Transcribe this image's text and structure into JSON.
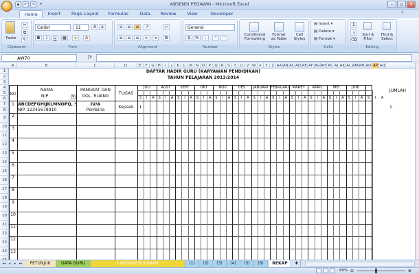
{
  "window": {
    "title": "ABSENSI PEGAWAI - Microsoft Excel"
  },
  "tabs": [
    "Home",
    "Insert",
    "Page Layout",
    "Formulas",
    "Data",
    "Review",
    "View",
    "Developer"
  ],
  "ribbon": {
    "clipboard": {
      "label": "Clipboard",
      "paste": "Paste"
    },
    "font": {
      "label": "Font",
      "name": "Calibri",
      "size": "11"
    },
    "alignment": {
      "label": "Alignment"
    },
    "number": {
      "label": "Number",
      "format": "General"
    },
    "styles": {
      "label": "Styles",
      "conditional": "Conditional",
      "conditional2": "Formatting",
      "format_table": "Format",
      "format_table2": "as Table",
      "cell_styles": "Cell",
      "cell_styles2": "Styles"
    },
    "cells": {
      "label": "Cells",
      "insert": "Insert",
      "delete": "Delete",
      "format": "Format"
    },
    "editing": {
      "label": "Editing",
      "sort": "Sort &",
      "sort2": "Filter",
      "find": "Find &",
      "find2": "Select"
    }
  },
  "formula_bar": {
    "name_box": "AW70",
    "fx": "fx",
    "content": ""
  },
  "sheet": {
    "title1": "DAFTAR HADIR GURU (KARYAWAN PENDIDIKAN)",
    "title2": "TAHUN PELAJARAN 2013/2014",
    "headers": {
      "no": "NO",
      "nama": "NAMA",
      "nip": "NIP",
      "pangkat1": "PANGKAT DAN",
      "pangkat2": "GOL. RUANG",
      "tugas": "TUGAS",
      "jumlah": "JUMLAH"
    },
    "months": [
      "JULI",
      "AGST",
      "SEPT",
      "OKT",
      "NOV",
      "DES",
      "JANUARI",
      "FEBRUARI",
      "MARET",
      "APRIL",
      "MEI",
      "JUNI"
    ],
    "sia": [
      "S",
      "I",
      "A"
    ],
    "row1": {
      "no": "1",
      "nama": "ABCDEFGHIJKLMNOPQ, S.Pd",
      "nip": "NIP. 12345678910",
      "gol": "IV/A",
      "pangkat": "Pembina",
      "tugas": "Kepsek",
      "juli_s": "1",
      "jumlah_s": "1"
    },
    "nums": [
      "2",
      "3",
      "4",
      "5",
      "6",
      "7",
      "8",
      "9",
      "10",
      "11",
      "12",
      "13"
    ]
  },
  "columns": [
    "A",
    "B",
    "C",
    "D",
    "E",
    "F",
    "G",
    "H",
    "I",
    "J",
    "K",
    "L",
    "M",
    "N",
    "O",
    "P",
    "Q",
    "R",
    "S",
    "T",
    "U",
    "V",
    "W",
    "X",
    "Y",
    "Z",
    "AA",
    "AB",
    "AC",
    "AD",
    "AE",
    "AF",
    "AG",
    "AH",
    "AI",
    "AJ",
    "AK",
    "AL",
    "AM",
    "AN",
    "AO",
    "AP",
    "AQ"
  ],
  "sheet_tabs": [
    "PETUNJUK",
    "DATA GURU",
    "LAPORAN BULANAN",
    "(1)",
    "(2)",
    "(3)",
    "(4)",
    "(5)",
    "(6)",
    "REKAP"
  ],
  "status": {
    "zoom": "80%"
  }
}
